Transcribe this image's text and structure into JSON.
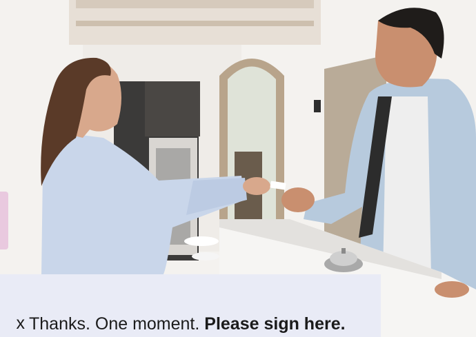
{
  "caption": {
    "edge_fragment": "x",
    "prefix": "Thanks. One moment. ",
    "emphasis": "Please sign here."
  },
  "colors": {
    "panel": "#e9ebf6",
    "accent_tab": "#e9c9df",
    "shirt_receptionist": "#c9d6ea",
    "shirt_guest": "#b7cadd"
  }
}
